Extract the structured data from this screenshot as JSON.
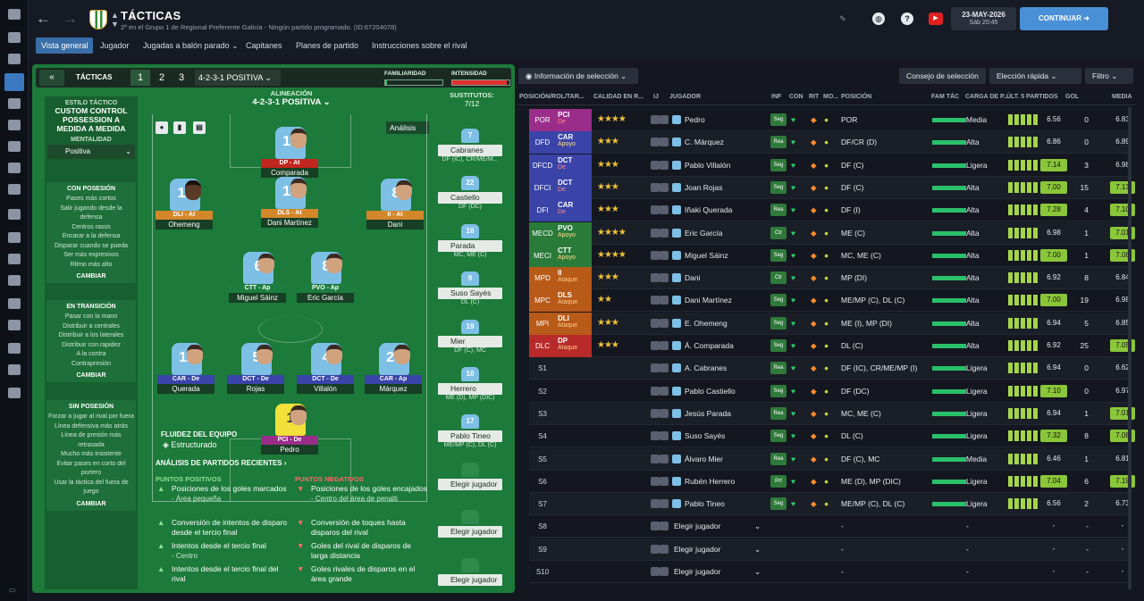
{
  "header": {
    "title": "TÁCTICAS",
    "subtitle": "2º en el Grupo 1 de Regional Preferente Galicia - Ningún partido programado. (ID:67204078)",
    "date": "23-MAY-2026",
    "time": "Sáb 20:45",
    "continue": "CONTINUAR"
  },
  "tabs": [
    "Vista general",
    "Jugador",
    "Jugadas a balón parado",
    "Capitanes",
    "Planes de partido",
    "Instrucciones sobre el rival"
  ],
  "left": {
    "tacticas": "TÁCTICAS",
    "numbers": [
      "1",
      "2",
      "3"
    ],
    "formation": "4-2-3-1 POSITIVA",
    "familiaridad": "FAMILIARIDAD",
    "intensidad": "INTENSIDAD",
    "familiaridad_value": 0.03,
    "intensidad_value": 0.95,
    "estilo_label": "ESTILO TÁCTICO",
    "estilo_val": "CUSTOM CONTROL POSSESSION A MEDIDA A MEDIDA",
    "mentalidad_label": "MENTALIDAD",
    "mentalidad": "Positiva",
    "con_posesion": {
      "title": "CON POSESIÓN",
      "lines": [
        "Pases más cortos",
        "Salir jugando desde la defensa",
        "Centros rasos",
        "Encarar a la defensa",
        "Disparar cuando se pueda",
        "Ser más expresivos",
        "Ritmo más alto"
      ]
    },
    "transicion": {
      "title": "EN TRANSICIÓN",
      "lines": [
        "Pasar con la mano",
        "Distribuir a centrales",
        "Distribuir a los laterales",
        "Distribuir con rapidez",
        "A la contra",
        "Contrapresión"
      ]
    },
    "sin_posesion": {
      "title": "SIN POSESIÓN",
      "lines": [
        "Forzar a jugar al rival por fuera",
        "Línea defensiva más atrás",
        "Línea de presión más retrasada",
        "Mucho más insistente",
        "Evitar pases en corto del portero",
        "Usar la táctica del fuera de juego"
      ]
    },
    "cambiar": "CAMBIAR",
    "alineacion_label": "ALINEACIÓN",
    "alineacion": "4-2-3-1 POSITIVA",
    "analisis_btn": "Análisis",
    "fluidez_label": "FLUIDEZ DEL EQUIPO",
    "fluidez": "Estructurado",
    "sustitutos": "SUSTITUTOS:",
    "sustitutos_count": "7/12",
    "analisis_title": "ANÁLISIS DE PARTIDOS RECIENTES",
    "pos_title": "PUNTOS POSITIVOS",
    "neg_title": "PUNTOS NEGATIVOS",
    "positivos": [
      {
        "t": "Posiciones de los goles marcados",
        "s": "- Área pequeña"
      },
      {
        "t": "Conversión de intentos de disparo desde el tercio final",
        "s": ""
      },
      {
        "t": "Intentos desde el tercio final",
        "s": "- Centro"
      },
      {
        "t": "Intentos desde el tercio final del rival",
        "s": ""
      }
    ],
    "negativos": [
      {
        "t": "Posiciones de los goles encajados",
        "s": "- Centro del área de penalti"
      },
      {
        "t": "Conversión de toques hasta disparos del rival",
        "s": ""
      },
      {
        "t": "Goles del rival de disparos de larga distancia",
        "s": ""
      },
      {
        "t": "Goles rivales de disparos en el área grande",
        "s": ""
      }
    ]
  },
  "pitch_players": [
    {
      "num": "19",
      "role": "DP - At",
      "name": "Comparada",
      "face": "lt"
    },
    {
      "num": "11",
      "role": "DLI - At",
      "name": "Ohemeng",
      "face": "dk"
    },
    {
      "num": "14",
      "role": "DLS - At",
      "name": "Dani Martínez",
      "face": "lt"
    },
    {
      "num": "8",
      "role": "II - At",
      "name": "Dani",
      "face": "lt"
    },
    {
      "num": "6",
      "role": "CTT - Ap",
      "name": "Miguel Sáinz",
      "face": "lt"
    },
    {
      "num": "8",
      "role": "PVO - Ap",
      "name": "Eric García",
      "face": "lt"
    },
    {
      "num": "12",
      "role": "CAR - De",
      "name": "Querada",
      "face": "lt"
    },
    {
      "num": "5",
      "role": "DCT - De",
      "name": "Rojas",
      "face": "lt"
    },
    {
      "num": "4",
      "role": "DCT - De",
      "name": "Villalón",
      "face": "lt"
    },
    {
      "num": "21",
      "role": "CAR - Ap",
      "name": "Márquez",
      "face": "lt"
    },
    {
      "num": "1",
      "role": "PCI - De",
      "name": "Pedro",
      "face": "lt"
    }
  ],
  "subs": [
    {
      "num": "7",
      "name": "Cabranes",
      "pos": "DF (IC), CR/ME/M..."
    },
    {
      "num": "22",
      "name": "Castiello",
      "pos": "DF (DC)"
    },
    {
      "num": "16",
      "name": "Parada",
      "pos": "MC, ME (C)"
    },
    {
      "num": "9",
      "name": "Suso Sayés",
      "pos": "DL (C)"
    },
    {
      "num": "19",
      "name": "Mier",
      "pos": "DF (C), MC"
    },
    {
      "num": "10",
      "name": "Herrero",
      "pos": "ME (D), MP (DIC)"
    },
    {
      "num": "17",
      "name": "Pablo Tineo",
      "pos": "ME/MP (C), DL (C)"
    },
    {
      "num": "",
      "name": "Elegir jugador",
      "pos": ""
    },
    {
      "num": "",
      "name": "Elegir jugador",
      "pos": ""
    },
    {
      "num": "",
      "name": "Elegir jugador",
      "pos": ""
    }
  ],
  "right": {
    "info_sel": "Información de selección",
    "consejo": "Consejo de selección",
    "eleccion": "Elección rápida",
    "filtro": "Filtro",
    "headers": [
      "POSICIÓN/ROL/TAR...",
      "CALIDAD EN R...",
      "IJ",
      "JUGADOR",
      "INF",
      "CON",
      "RIT",
      "MO...",
      "POSICIÓN",
      "FAM TÁC",
      "CARGA DE P...",
      "ÚLT. 5 PARTIDOS",
      "GOL",
      "MEDIA"
    ],
    "rows": [
      {
        "pos": "POR",
        "role": "PCI",
        "duty": "De",
        "col": "#9a2d8a",
        "stars": "★★★★",
        "name": "Pedro",
        "inf": "Seg",
        "posi": "POR",
        "carga": "Media",
        "rat": "6.56",
        "gol": "0",
        "avg": "6.83",
        "g": false,
        "ag": false
      },
      {
        "pos": "DFD",
        "role": "CAR",
        "duty": "Apoyo",
        "col": "#3a44a8",
        "stars": "★★★",
        "name": "C. Márquez",
        "inf": "Rea",
        "posi": "DF/CR (D)",
        "carga": "Alta",
        "rat": "6.86",
        "gol": "0",
        "avg": "6.89",
        "g": false,
        "ag": false
      },
      {
        "pos": "DFCD",
        "role": "DCT",
        "duty": "De",
        "col": "#3a44a8",
        "stars": "★★★",
        "name": "Pablo Villalón",
        "inf": "Seg",
        "posi": "DF (C)",
        "carga": "Ligera",
        "rat": "7.14",
        "gol": "3",
        "avg": "6.98",
        "g": true,
        "ag": false
      },
      {
        "pos": "DFCI",
        "role": "DCT",
        "duty": "De",
        "col": "#3a44a8",
        "stars": "★★★",
        "name": "Joan Rojas",
        "inf": "Seg",
        "posi": "DF (C)",
        "carga": "Alta",
        "rat": "7.00",
        "gol": "15",
        "avg": "7.13",
        "g": true,
        "ag": true
      },
      {
        "pos": "DFI",
        "role": "CAR",
        "duty": "De",
        "col": "#3a44a8",
        "stars": "★★★",
        "name": "Iñaki Querada",
        "inf": "Rea",
        "posi": "DF (I)",
        "carga": "Alta",
        "rat": "7.28",
        "gol": "4",
        "avg": "7.10",
        "g": true,
        "ag": true
      },
      {
        "pos": "MECD",
        "role": "PVO",
        "duty": "Apoyo",
        "col": "#2a7a3a",
        "stars": "★★★★",
        "name": "Eric García",
        "inf": "Ctr",
        "posi": "ME (C)",
        "carga": "Alta",
        "rat": "6.98",
        "gol": "1",
        "avg": "7.01",
        "g": false,
        "ag": true
      },
      {
        "pos": "MECI",
        "role": "CTT",
        "duty": "Apoyo",
        "col": "#2a7a3a",
        "stars": "★★★★",
        "name": "Miguel Sáinz",
        "inf": "Seg",
        "posi": "MC, ME (C)",
        "carga": "Alta",
        "rat": "7.00",
        "gol": "1",
        "avg": "7.08",
        "g": true,
        "ag": true
      },
      {
        "pos": "MPD",
        "role": "II",
        "duty": "Ataque",
        "col": "#b85a18",
        "stars": "★★★",
        "name": "Dani",
        "inf": "Ctr",
        "posi": "MP (DI)",
        "carga": "Alta",
        "rat": "6.92",
        "gol": "8",
        "avg": "6.84",
        "g": false,
        "ag": false
      },
      {
        "pos": "MPC",
        "role": "DLS",
        "duty": "Ataque",
        "col": "#b85a18",
        "stars": "★★",
        "name": "Dani Martínez",
        "inf": "Seg",
        "posi": "ME/MP (C), DL (C)",
        "carga": "Alta",
        "rat": "7.00",
        "gol": "19",
        "avg": "6.98",
        "g": true,
        "ag": false
      },
      {
        "pos": "MPI",
        "role": "DLI",
        "duty": "Ataque",
        "col": "#b85a18",
        "stars": "★★★",
        "name": "E. Ohemeng",
        "inf": "Seg",
        "posi": "ME (I), MP (DI)",
        "carga": "Alta",
        "rat": "6.94",
        "gol": "5",
        "avg": "6.85",
        "g": false,
        "ag": false
      },
      {
        "pos": "DLC",
        "role": "DP",
        "duty": "Ataque",
        "col": "#b82a2a",
        "stars": "★★★",
        "name": "Á. Comparada",
        "inf": "Seg",
        "posi": "DL (C)",
        "carga": "Alta",
        "rat": "6.92",
        "gol": "25",
        "avg": "7.05",
        "g": false,
        "ag": true
      },
      {
        "pos": "S1",
        "role": "",
        "duty": "",
        "col": "",
        "stars": "",
        "name": "A. Cabranes",
        "inf": "Rea",
        "posi": "DF (IC), CR/ME/MP (I)",
        "carga": "Ligera",
        "rat": "6.94",
        "gol": "0",
        "avg": "6.62",
        "g": false,
        "ag": false
      },
      {
        "pos": "S2",
        "role": "",
        "duty": "",
        "col": "",
        "stars": "",
        "name": "Pablo Castiello",
        "inf": "Seg",
        "posi": "DF (DC)",
        "carga": "Ligera",
        "rat": "7.10",
        "gol": "0",
        "avg": "6.97",
        "g": true,
        "ag": false
      },
      {
        "pos": "S3",
        "role": "",
        "duty": "",
        "col": "",
        "stars": "",
        "name": "Jesús Parada",
        "inf": "Rea",
        "posi": "MC, ME (C)",
        "carga": "Ligera",
        "rat": "6.94",
        "gol": "1",
        "avg": "7.01",
        "g": false,
        "ag": true
      },
      {
        "pos": "S4",
        "role": "",
        "duty": "",
        "col": "",
        "stars": "",
        "name": "Suso Sayés",
        "inf": "Seg",
        "posi": "DL (C)",
        "carga": "Ligera",
        "rat": "7.32",
        "gol": "8",
        "avg": "7.08",
        "g": true,
        "ag": true
      },
      {
        "pos": "S5",
        "role": "",
        "duty": "",
        "col": "",
        "stars": "",
        "name": "Álvaro Mier",
        "inf": "Rea",
        "posi": "DF (C), MC",
        "carga": "Media",
        "rat": "6.46",
        "gol": "1",
        "avg": "6.81",
        "g": false,
        "ag": false
      },
      {
        "pos": "S6",
        "role": "",
        "duty": "",
        "col": "",
        "stars": "",
        "name": "Rubén Herrero",
        "inf": "Prf",
        "posi": "ME (D), MP (DIC)",
        "carga": "Ligera",
        "rat": "7.04",
        "gol": "6",
        "avg": "7.19",
        "g": true,
        "ag": true
      },
      {
        "pos": "S7",
        "role": "",
        "duty": "",
        "col": "",
        "stars": "",
        "name": "Pablo Tineo",
        "inf": "Seg",
        "posi": "ME/MP (C), DL (C)",
        "carga": "Ligera",
        "rat": "6.56",
        "gol": "2",
        "avg": "6.73",
        "g": false,
        "ag": false
      },
      {
        "pos": "S8",
        "role": "",
        "duty": "",
        "col": "",
        "stars": "",
        "name": "Elegir jugador",
        "inf": "",
        "posi": "-",
        "carga": "-",
        "rat": "-",
        "gol": "-",
        "avg": "-",
        "g": false,
        "ag": false
      },
      {
        "pos": "S9",
        "role": "",
        "duty": "",
        "col": "",
        "stars": "",
        "name": "Elegir jugador",
        "inf": "",
        "posi": "-",
        "carga": "-",
        "rat": "-",
        "gol": "-",
        "avg": "-",
        "g": false,
        "ag": false
      },
      {
        "pos": "S10",
        "role": "",
        "duty": "",
        "col": "",
        "stars": "",
        "name": "Elegir jugador",
        "inf": "",
        "posi": "-",
        "carga": "-",
        "rat": "-",
        "gol": "-",
        "avg": "-",
        "g": false,
        "ag": false
      }
    ]
  }
}
